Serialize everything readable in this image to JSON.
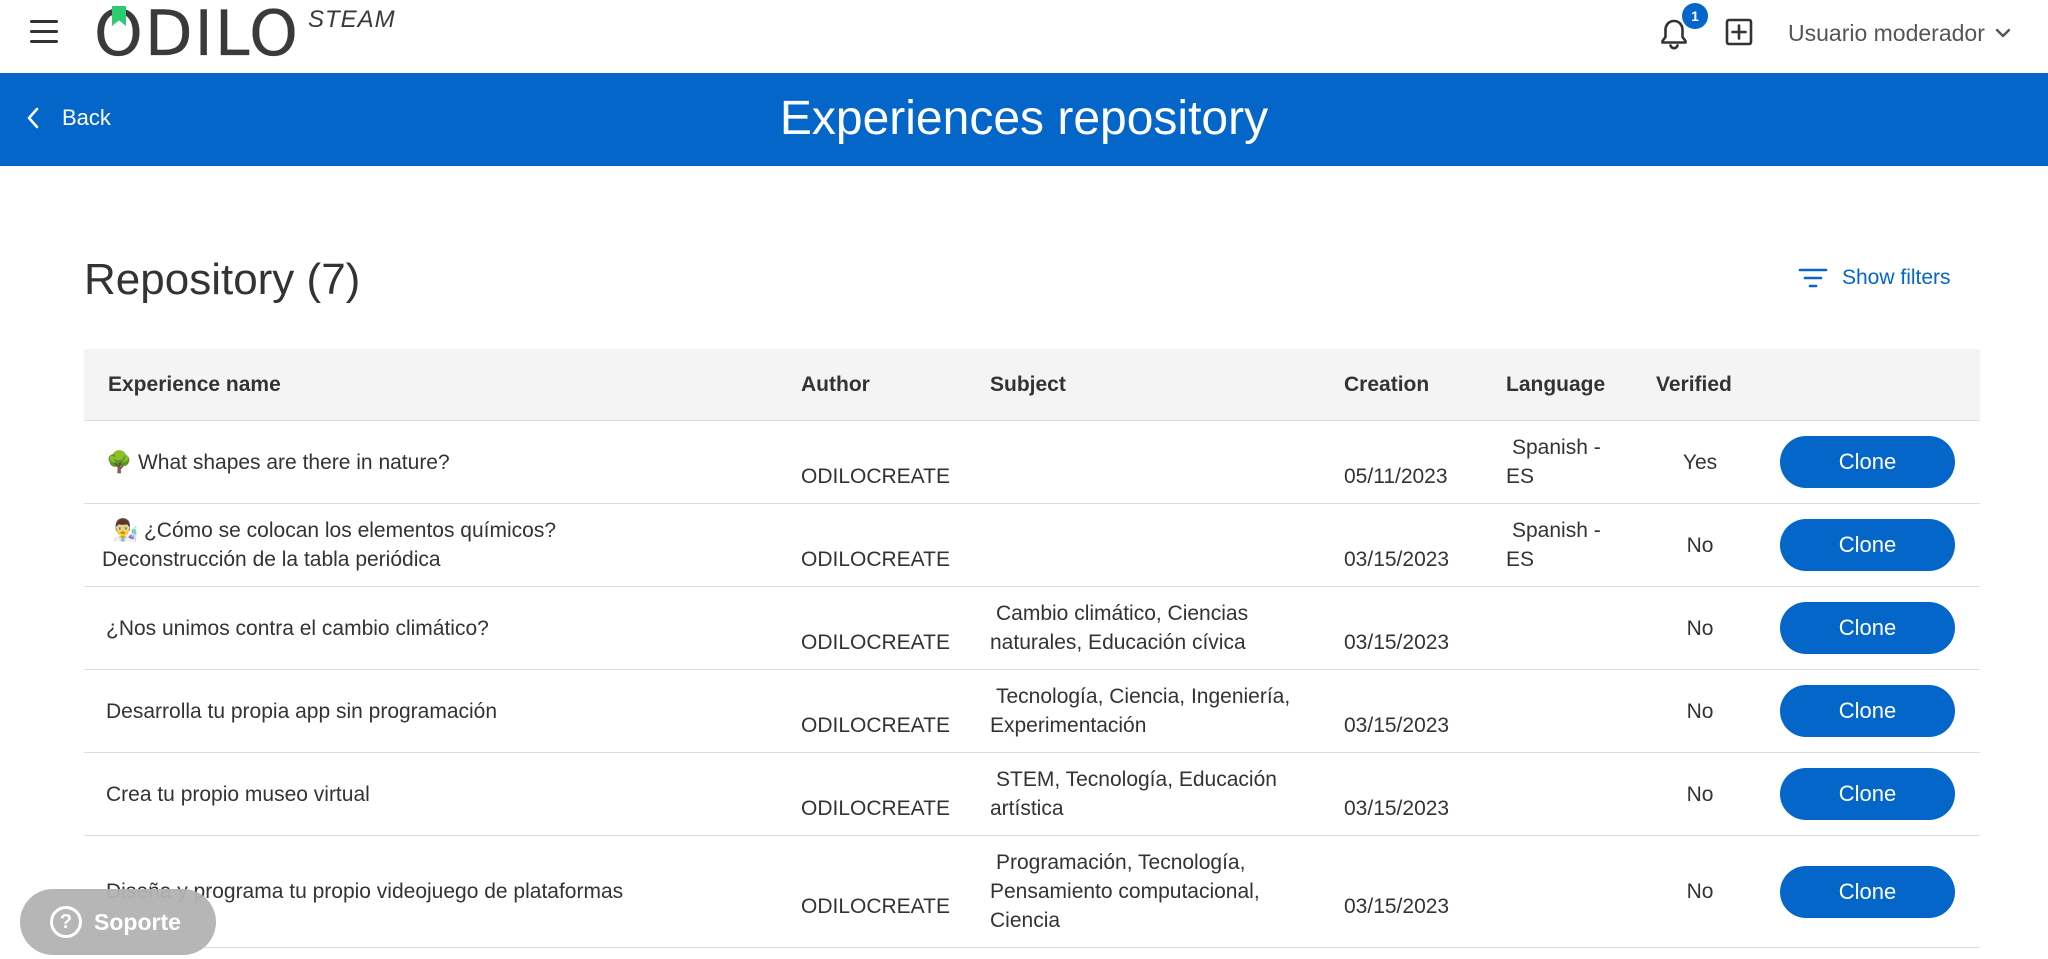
{
  "app": {
    "logo_text": "ODILO",
    "logo_suffix": "STEAM"
  },
  "topbar": {
    "notification_count": "1",
    "user_name": "Usuario moderador"
  },
  "header": {
    "back_label": "Back",
    "title": "Experiences repository"
  },
  "repository": {
    "title": "Repository (7)",
    "show_filters_label": "Show filters"
  },
  "table": {
    "columns": {
      "name": "Experience name",
      "author": "Author",
      "subject": "Subject",
      "creation": "Creation",
      "language": "Language",
      "verified": "Verified"
    },
    "rows": [
      {
        "name_line1": "🌳 What shapes are there in nature?",
        "name_line2": "",
        "author": "ODILOCREATE",
        "subject_line1": "",
        "subject_line2": "",
        "subject_line3": "",
        "creation": "05/11/2023",
        "language_line1": "Spanish -",
        "language_line2": "ES",
        "verified": "Yes",
        "action": "Clone"
      },
      {
        "name_line1": "👨‍🔬 ¿Cómo se colocan los elementos químicos?",
        "name_line2": "Deconstrucción de la tabla periódica",
        "author": "ODILOCREATE",
        "subject_line1": "",
        "subject_line2": "",
        "subject_line3": "",
        "creation": "03/15/2023",
        "language_line1": "Spanish -",
        "language_line2": "ES",
        "verified": "No",
        "action": "Clone"
      },
      {
        "name_line1": "¿Nos unimos contra el cambio climático?",
        "name_line2": "",
        "author": "ODILOCREATE",
        "subject_line1": "Cambio climático, Ciencias",
        "subject_line2": "naturales, Educación cívica",
        "subject_line3": "",
        "creation": "03/15/2023",
        "language_line1": "",
        "language_line2": "",
        "verified": "No",
        "action": "Clone"
      },
      {
        "name_line1": "Desarrolla tu propia app sin programación",
        "name_line2": "",
        "author": "ODILOCREATE",
        "subject_line1": "Tecnología, Ciencia, Ingeniería,",
        "subject_line2": "Experimentación",
        "subject_line3": "",
        "creation": "03/15/2023",
        "language_line1": "",
        "language_line2": "",
        "verified": "No",
        "action": "Clone"
      },
      {
        "name_line1": "Crea tu propio museo virtual",
        "name_line2": "",
        "author": "ODILOCREATE",
        "subject_line1": "STEM, Tecnología, Educación",
        "subject_line2": "artística",
        "subject_line3": "",
        "creation": "03/15/2023",
        "language_line1": "",
        "language_line2": "",
        "verified": "No",
        "action": "Clone"
      },
      {
        "name_line1": "Diseña y programa tu propio videojuego de plataformas",
        "name_line2": "",
        "author": "ODILOCREATE",
        "subject_line1": "Programación, Tecnología,",
        "subject_line2": "Pensamiento computacional,",
        "subject_line3": "Ciencia",
        "creation": "03/15/2023",
        "language_line1": "",
        "language_line2": "",
        "verified": "No",
        "action": "Clone"
      }
    ]
  },
  "support": {
    "label": "Soporte",
    "icon": "question-icon"
  },
  "colors": {
    "primary": "#0366c8",
    "logo_accent": "#2ecc71",
    "table_header_bg": "#f4f4f4",
    "support_bg": "#b3b3b3"
  },
  "icons": {
    "menu": "hamburger-menu-icon",
    "bell": "bell-icon",
    "add": "plus-square-icon",
    "dropdown": "chevron-down-icon",
    "back": "chevron-left-icon",
    "filter": "filter-icon"
  }
}
